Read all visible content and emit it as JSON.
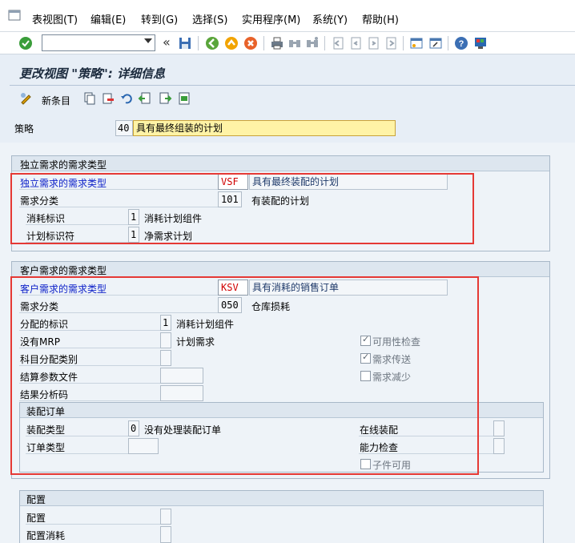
{
  "menu": {
    "items": [
      "表视图(T)",
      "编辑(E)",
      "转到(G)",
      "选择(S)",
      "实用程序(M)",
      "系统(Y)",
      "帮助(H)"
    ]
  },
  "toolbar": {
    "command_value": "",
    "history_label": "«",
    "icons": [
      "enter-icon",
      "save-icon",
      "back-icon",
      "exit-icon",
      "cancel-icon",
      "print-icon",
      "find-icon",
      "find-next-icon",
      "first-page-icon",
      "previous-page-icon",
      "next-page-icon",
      "last-page-icon",
      "create-session-icon",
      "shortcut-icon",
      "help-icon",
      "customize-layout-icon"
    ]
  },
  "page": {
    "title": "更改视图 \"策略\": 详细信息",
    "new_entries_label": "新条目"
  },
  "strategy": {
    "label": "策略",
    "code": "40",
    "text": "具有最终组装的计划"
  },
  "indep": {
    "group_title": "独立需求的需求类型",
    "req_type_label": "独立需求的需求类型",
    "req_type_code": "VSF",
    "req_type_text": "具有最终装配的计划",
    "req_class_label": "需求分类",
    "req_class_code": "101",
    "req_class_text": "有装配的计划",
    "consumption_label": "消耗标识",
    "consumption_code": "1",
    "consumption_text": "消耗计划组件",
    "planning_ind_label": "计划标识符",
    "planning_ind_code": "1",
    "planning_ind_text": "净需求计划"
  },
  "cust": {
    "group_title": "客户需求的需求类型",
    "req_type_label": "客户需求的需求类型",
    "req_type_code": "KSV",
    "req_type_text": "具有消耗的销售订单",
    "req_class_label": "需求分类",
    "req_class_code": "050",
    "req_class_text": "仓库损耗",
    "alloc_label": "分配的标识",
    "alloc_code": "1",
    "alloc_text": "消耗计划组件",
    "no_mrp_label": "没有MRP",
    "no_mrp_text": "计划需求",
    "acct_assign_label": "科目分配类别",
    "settle_profile_label": "结算参数文件",
    "result_analysis_label": "结果分析码",
    "availability_label": "可用性检查",
    "availability_checked": true,
    "req_transfer_label": "需求传送",
    "req_transfer_checked": true,
    "req_reduction_label": "需求减少",
    "req_reduction_checked": false
  },
  "assembly": {
    "group_title": "装配订单",
    "type_label": "装配类型",
    "type_code": "0",
    "type_text": "没有处理装配订单",
    "order_type_label": "订单类型",
    "online_label": "在线装配",
    "capacity_label": "能力检查",
    "component_label": "子件可用"
  },
  "config": {
    "group_title": "配置",
    "config_label": "配置",
    "consumption_label": "配置消耗"
  },
  "colors": {
    "highlight_box": "#e53935",
    "required_field": "#fff3a6",
    "blue_label": "#0b1fc8"
  }
}
